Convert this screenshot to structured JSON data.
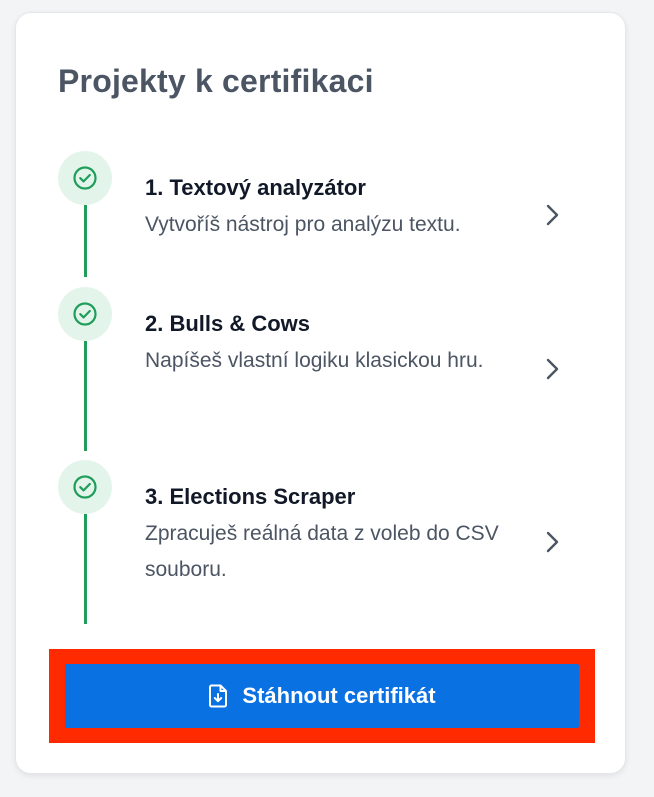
{
  "card": {
    "title": "Projekty k certifikaci"
  },
  "steps": [
    {
      "title": "1. Textový analyzátor",
      "description": "Vytvoříš nástroj pro analýzu textu.",
      "status_icon": "check-circle-icon",
      "action_icon": "chevron-right-icon"
    },
    {
      "title": "2. Bulls & Cows",
      "description": "Napíšeš vlastní logiku klasickou hru.",
      "status_icon": "check-circle-icon",
      "action_icon": "chevron-right-icon"
    },
    {
      "title": "3. Elections Scraper",
      "description": "Zpracuješ reálná data z voleb do CSV souboru.",
      "status_icon": "check-circle-icon",
      "action_icon": "chevron-right-icon"
    }
  ],
  "download": {
    "label": "Stáhnout certifikát",
    "icon": "file-download-icon"
  },
  "colors": {
    "accent": "#0a71e3",
    "success": "#1f9d5a",
    "success_bg": "#e3f5ea",
    "highlight": "#ff2a00"
  }
}
